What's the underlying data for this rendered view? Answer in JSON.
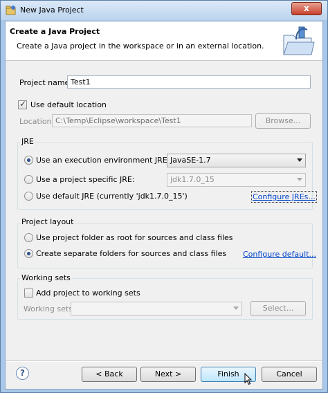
{
  "window": {
    "title": "New Java Project",
    "close_label": "x"
  },
  "header": {
    "title": "Create a Java Project",
    "description": "Create a Java project in the workspace or in an external location."
  },
  "project": {
    "name_label": "Project name:",
    "name_value": "Test1",
    "use_default_label": "Use default location",
    "location_label": "Location:",
    "location_value": "C:\\Temp\\Eclipse\\workspace\\Test1",
    "browse_label": "Browse..."
  },
  "jre": {
    "title": "JRE",
    "exec_env_label": "Use an execution environment JRE:",
    "exec_env_value": "JavaSE-1.7",
    "project_specific_label": "Use a project specific JRE:",
    "project_specific_value": "jdk1.7.0_15",
    "default_label": "Use default JRE (currently 'jdk1.7.0_15')",
    "configure_link": "Configure JREs..."
  },
  "layout": {
    "title": "Project layout",
    "root_label": "Use project folder as root for sources and class files",
    "separate_label": "Create separate folders for sources and class files",
    "configure_link": "Configure default..."
  },
  "working_sets": {
    "title": "Working sets",
    "add_label": "Add project to working sets",
    "sets_label": "Working sets:",
    "select_label": "Select..."
  },
  "footer": {
    "help_label": "?",
    "back_label": "< Back",
    "next_label": "Next >",
    "finish_label": "Finish",
    "cancel_label": "Cancel"
  }
}
